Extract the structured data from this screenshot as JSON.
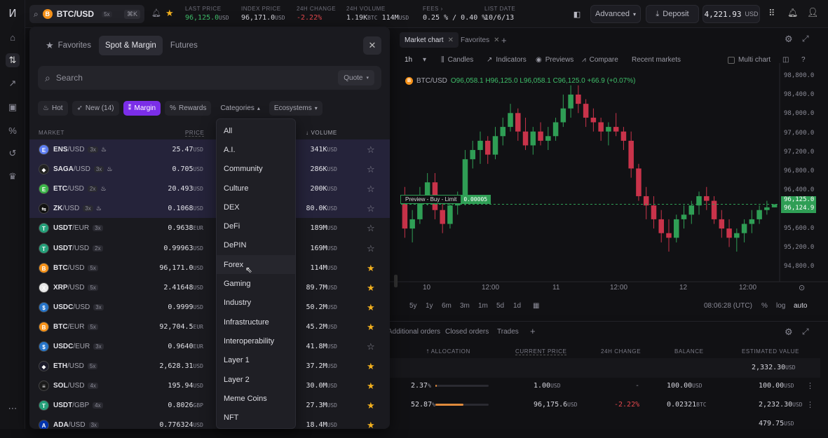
{
  "topbar": {
    "symbol": "BTC/USD",
    "leverage": "5x",
    "shortcut": "⌘K",
    "stats": [
      {
        "label": "LAST PRICE",
        "value": "96,125.0",
        "unit": "USD",
        "color": "#3fbf6a"
      },
      {
        "label": "INDEX PRICE",
        "value": "96,171.0",
        "unit": "USD",
        "color": "#d6d6de"
      },
      {
        "label": "24H CHANGE",
        "value": "-2.22%",
        "unit": "",
        "color": "#e5484d"
      },
      {
        "label": "24H VOLUME",
        "value": "1.19K",
        "unit": "BTC",
        "value2": "114M",
        "unit2": "USD",
        "color": "#d6d6de"
      },
      {
        "label": "FEES",
        "value": "0.25 % / 0.40 %",
        "unit": "",
        "color": "#d6d6de"
      },
      {
        "label": "LIST DATE",
        "value": "10/6/13",
        "unit": "",
        "color": "#d6d6de"
      }
    ],
    "mode": "Advanced",
    "deposit": "Deposit",
    "balance": "4,221.93",
    "balance_unit": "USD"
  },
  "market": {
    "tabs": [
      "Favorites",
      "Spot & Margin",
      "Futures"
    ],
    "active_tab": "Spot & Margin",
    "search_placeholder": "Search",
    "quote_label": "Quote",
    "chips": [
      "Hot",
      "New (14)",
      "Margin",
      "Rewards",
      "Categories",
      "Ecosystems"
    ],
    "col_market": "MARKET",
    "col_price": "PRICE",
    "col_volume": "VOLUME",
    "rows": [
      {
        "base": "ENS",
        "quote": "/USD",
        "lev": "3x",
        "hot": true,
        "price": "25.47",
        "pu": "USD",
        "vol": "341K",
        "vu": "USD",
        "fav": false,
        "color": "#5d7df2",
        "glyph": "E"
      },
      {
        "base": "SAGA",
        "quote": "/USD",
        "lev": "3x",
        "hot": true,
        "price": "0.705",
        "pu": "USD",
        "vol": "286K",
        "vu": "USD",
        "fav": false,
        "color": "#222",
        "glyph": "◆"
      },
      {
        "base": "ETC",
        "quote": "/USD",
        "lev": "2x",
        "hot": true,
        "price": "20.493",
        "pu": "USD",
        "vol": "200K",
        "vu": "USD",
        "fav": false,
        "color": "#3cb64a",
        "glyph": "E"
      },
      {
        "base": "ZK",
        "quote": "/USD",
        "lev": "3x",
        "hot": true,
        "price": "0.1068",
        "pu": "USD",
        "vol": "80.0K",
        "vu": "USD",
        "fav": false,
        "color": "#111",
        "glyph": "⇆"
      },
      {
        "base": "USDT",
        "quote": "/EUR",
        "lev": "3x",
        "hot": false,
        "price": "0.9638",
        "pu": "EUR",
        "vol": "189M",
        "vu": "USD",
        "fav": false,
        "color": "#26a17b",
        "glyph": "T"
      },
      {
        "base": "USDT",
        "quote": "/USD",
        "lev": "2x",
        "hot": false,
        "price": "0.99963",
        "pu": "USD",
        "vol": "169M",
        "vu": "USD",
        "fav": false,
        "color": "#26a17b",
        "glyph": "T"
      },
      {
        "base": "BTC",
        "quote": "/USD",
        "lev": "5x",
        "hot": false,
        "price": "96,171.0",
        "pu": "USD",
        "vol": "114M",
        "vu": "USD",
        "fav": true,
        "color": "#f7931a",
        "glyph": "B"
      },
      {
        "base": "XRP",
        "quote": "/USD",
        "lev": "5x",
        "hot": false,
        "price": "2.41648",
        "pu": "USD",
        "vol": "89.7M",
        "vu": "USD",
        "fav": true,
        "color": "#e8e8e8",
        "glyph": "X"
      },
      {
        "base": "USDC",
        "quote": "/USD",
        "lev": "3x",
        "hot": false,
        "price": "0.9999",
        "pu": "USD",
        "vol": "50.2M",
        "vu": "USD",
        "fav": true,
        "color": "#2775ca",
        "glyph": "$"
      },
      {
        "base": "BTC",
        "quote": "/EUR",
        "lev": "5x",
        "hot": false,
        "price": "92,704.5",
        "pu": "EUR",
        "vol": "45.2M",
        "vu": "USD",
        "fav": true,
        "color": "#f7931a",
        "glyph": "B"
      },
      {
        "base": "USDC",
        "quote": "/EUR",
        "lev": "3x",
        "hot": false,
        "price": "0.9640",
        "pu": "EUR",
        "vol": "41.8M",
        "vu": "USD",
        "fav": false,
        "color": "#2775ca",
        "glyph": "$"
      },
      {
        "base": "ETH",
        "quote": "/USD",
        "lev": "5x",
        "hot": false,
        "price": "2,628.31",
        "pu": "USD",
        "vol": "37.2M",
        "vu": "USD",
        "fav": true,
        "color": "#1b1b2b",
        "glyph": "◆"
      },
      {
        "base": "SOL",
        "quote": "/USD",
        "lev": "4x",
        "hot": false,
        "price": "195.94",
        "pu": "USD",
        "vol": "30.0M",
        "vu": "USD",
        "fav": true,
        "color": "#1a1a1a",
        "glyph": "≡"
      },
      {
        "base": "USDT",
        "quote": "/GBP",
        "lev": "4x",
        "hot": false,
        "price": "0.8026",
        "pu": "GBP",
        "vol": "27.3M",
        "vu": "USD",
        "fav": true,
        "color": "#26a17b",
        "glyph": "T"
      },
      {
        "base": "ADA",
        "quote": "/USD",
        "lev": "3x",
        "hot": false,
        "price": "0.776324",
        "pu": "USD",
        "vol": "18.4M",
        "vu": "USD",
        "fav": true,
        "color": "#0033ad",
        "glyph": "A"
      }
    ]
  },
  "categories_dropdown": {
    "items": [
      "All",
      "A.I.",
      "Community",
      "Culture",
      "DEX",
      "DeFi",
      "DePIN",
      "Forex",
      "Gaming",
      "Industry",
      "Infrastructure",
      "Interoperability",
      "Layer 1",
      "Layer 2",
      "Meme Coins",
      "NFT"
    ],
    "hovered": "Forex"
  },
  "chart": {
    "tabs": [
      "Market chart",
      "Favorites"
    ],
    "interval": "1h",
    "tools": [
      "Candles",
      "Indicators",
      "Previews",
      "Compare",
      "Recent markets"
    ],
    "multi_chart": "Multi chart",
    "legend_symbol": "BTC/USD",
    "ohlc": "O96,058.1 H96,125.0 L96,058.1 C96,125.0 +66.9 (+0.07%)",
    "preview_label": "Preview - Buy - Limit",
    "preview_qty": "0.00005",
    "price_tag_1": "96,125.0",
    "price_tag_2": "96,124.9",
    "y_labels": [
      "98,800.0",
      "98,400.0",
      "98,000.0",
      "97,600.0",
      "97,200.0",
      "96,800.0",
      "96,400.0",
      "96,000.0",
      "95,600.0",
      "95,200.0",
      "94,800.0"
    ],
    "x_labels": [
      "10",
      "12:00",
      "11",
      "12:00",
      "12",
      "12:00"
    ],
    "ranges": [
      "5y",
      "1y",
      "6m",
      "3m",
      "1m",
      "5d",
      "1d"
    ],
    "clock": "08:06:28 (UTC)",
    "scale_opts": [
      "%",
      "log",
      "auto"
    ],
    "up_color": "#2f9e55",
    "down_color": "#c9334a"
  },
  "chart_data": {
    "type": "candlestick",
    "symbol": "BTC/USD",
    "interval": "1h",
    "ylim": [
      94600,
      99000
    ],
    "last_price": 96125.0,
    "candles": [
      [
        96200,
        96500,
        95400,
        95600
      ],
      [
        95600,
        96000,
        95300,
        95800
      ],
      [
        95800,
        96500,
        95700,
        96300
      ],
      [
        96300,
        96800,
        96100,
        96600
      ],
      [
        96600,
        96800,
        95800,
        96000
      ],
      [
        96000,
        96300,
        95500,
        95700
      ],
      [
        95700,
        96200,
        95600,
        96100
      ],
      [
        96100,
        96400,
        95900,
        96200
      ],
      [
        96200,
        97300,
        96100,
        97100
      ],
      [
        97100,
        97500,
        96900,
        97300
      ],
      [
        97300,
        97700,
        97000,
        97500
      ],
      [
        97500,
        97600,
        97000,
        97200
      ],
      [
        97200,
        97800,
        97100,
        97600
      ],
      [
        97600,
        98000,
        97400,
        97800
      ],
      [
        97800,
        98300,
        97700,
        98100
      ],
      [
        98100,
        98200,
        97500,
        97700
      ],
      [
        97700,
        98000,
        97300,
        97400
      ],
      [
        97400,
        97800,
        97200,
        97700
      ],
      [
        97700,
        97900,
        97400,
        97500
      ],
      [
        97500,
        97800,
        97300,
        97600
      ],
      [
        97600,
        98000,
        97500,
        97900
      ],
      [
        97900,
        98500,
        97800,
        98200
      ],
      [
        98200,
        98700,
        98000,
        98500
      ],
      [
        98500,
        98700,
        98100,
        98300
      ],
      [
        98300,
        98400,
        97800,
        98000
      ],
      [
        98000,
        98200,
        97700,
        97900
      ],
      [
        97900,
        98000,
        97500,
        97700
      ],
      [
        97700,
        97900,
        97400,
        97800
      ],
      [
        97800,
        98100,
        97600,
        97700
      ],
      [
        97700,
        97800,
        97300,
        97500
      ],
      [
        97500,
        97700,
        96700,
        96900
      ],
      [
        96900,
        97000,
        96200,
        96300
      ],
      [
        96300,
        96500,
        95800,
        96100
      ],
      [
        96100,
        96300,
        95600,
        95800
      ],
      [
        95800,
        96000,
        95300,
        95500
      ],
      [
        95500,
        95800,
        95100,
        95400
      ],
      [
        95400,
        95900,
        95300,
        95800
      ],
      [
        95800,
        96100,
        95600,
        95900
      ],
      [
        95900,
        96200,
        95700,
        96100
      ],
      [
        96100,
        96400,
        95900,
        96300
      ],
      [
        96300,
        96500,
        96000,
        96200
      ],
      [
        96200,
        96300,
        95700,
        95800
      ],
      [
        95800,
        96000,
        95400,
        95600
      ],
      [
        95600,
        95800,
        95200,
        95400
      ],
      [
        95400,
        95600,
        95100,
        95500
      ],
      [
        95500,
        95800,
        95300,
        95700
      ],
      [
        95700,
        96000,
        95500,
        95800
      ],
      [
        95800,
        96100,
        95700,
        96000
      ],
      [
        96000,
        96200,
        95900,
        96058.1
      ],
      [
        96058.1,
        96125,
        96058.1,
        96125
      ]
    ]
  },
  "orders": {
    "tabs": [
      "Additional orders",
      "Closed orders",
      "Trades"
    ],
    "headers": [
      "ALLOCATION",
      "CURRENT PRICE",
      "24H CHANGE",
      "BALANCE",
      "ESTIMATED VALUE"
    ],
    "total": "2,332.30",
    "total_unit": "USD",
    "rows": [
      {
        "alloc": "2.37",
        "alloc_frac": 0.0237,
        "price": "1.00",
        "pu": "USD",
        "change": "-",
        "balance": "100.00",
        "bu": "USD",
        "est": "100.00",
        "eu": "USD"
      },
      {
        "alloc": "52.87",
        "alloc_frac": 0.5287,
        "price": "96,175.6",
        "pu": "USD",
        "change": "-2.22%",
        "balance": "0.02321",
        "bu": "BTC",
        "est": "2,232.30",
        "eu": "USD"
      },
      {
        "alloc": "",
        "alloc_frac": 0,
        "price": "",
        "pu": "",
        "change": "",
        "balance": "",
        "bu": "",
        "est": "479.75",
        "eu": "USD"
      }
    ]
  }
}
